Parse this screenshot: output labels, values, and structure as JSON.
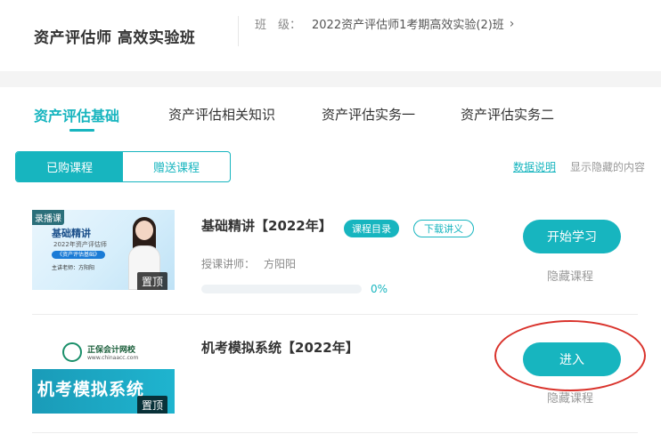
{
  "header": {
    "course_name": "资产评估师 高效实验班",
    "class_prefix": "班　级：",
    "class_value": "2022资产评估师1考期高效实验(2)班",
    "class_chevron": "›"
  },
  "tabs": [
    {
      "label": "资产评估基础",
      "active": true
    },
    {
      "label": "资产评估相关知识",
      "active": false
    },
    {
      "label": "资产评估实务一",
      "active": false
    },
    {
      "label": "资产评估实务二",
      "active": false
    }
  ],
  "toggle": {
    "purchased": "已购课程",
    "gifted": "赠送课程"
  },
  "links": {
    "data_explain": "数据说明",
    "show_hidden": "显示隐藏的内容"
  },
  "courses": [
    {
      "title": "基础精讲【2022年】",
      "thumb": {
        "badge": "录播课",
        "title": "基础精讲",
        "subtitle": "2022年资产评估师",
        "pill": "《资产评估基础》",
        "teacher": "主讲老师：方阳阳"
      },
      "pin_label": "置顶",
      "tag_catalog": "课程目录",
      "tag_handout": "下载讲义",
      "teacher_label": "授课讲师：",
      "teacher_name": "方阳阳",
      "progress_fraction": 0,
      "progress_text": "0%",
      "action_label": "开始学习",
      "hide_label": "隐藏课程"
    },
    {
      "title": "机考模拟系统【2022年】",
      "thumb": {
        "logo_text": "正保会计网校",
        "logo_url": "www.chinaacc.com",
        "band_text": "机考模拟系统"
      },
      "pin_label": "置顶",
      "action_label": "进入",
      "hide_label": "隐藏课程"
    }
  ],
  "colors": {
    "accent": "#17b5bf",
    "annotation": "#d9322b"
  }
}
